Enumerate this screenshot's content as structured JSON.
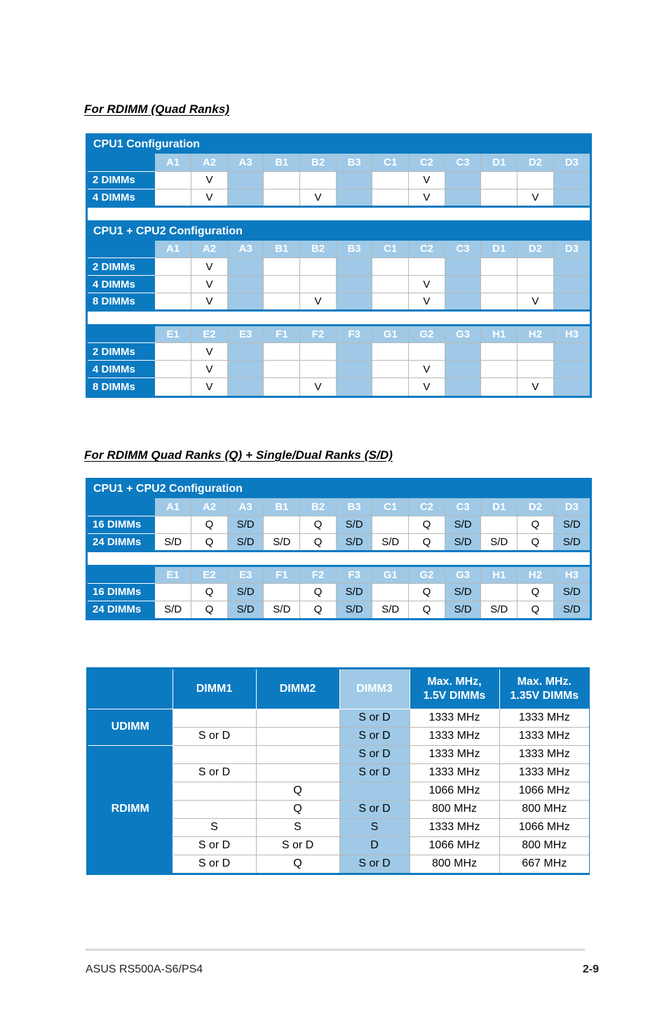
{
  "document": {
    "footer_left": "ASUS RS500A-S6/PS4",
    "page_number": "2-9"
  },
  "colors": {
    "brand_blue": "#0c7ac1",
    "light_blue": "#9fc9e6",
    "grid_gray": "#b8b8b8",
    "footer_rule": "#d9d9d9"
  },
  "section1": {
    "heading": "For RDIMM (Quad Ranks)",
    "block1": {
      "title": "CPU1 Configuration",
      "columns": [
        "A1",
        "A2",
        "A3",
        "B1",
        "B2",
        "B3",
        "C1",
        "C2",
        "C3",
        "D1",
        "D2",
        "D3"
      ],
      "shaded_columns": [
        2,
        5,
        8,
        11
      ],
      "rows": [
        {
          "label": "2 DIMMs",
          "values": [
            "",
            "V",
            "",
            "",
            "",
            "",
            "",
            "V",
            "",
            "",
            "",
            ""
          ]
        },
        {
          "label": "4 DIMMs",
          "values": [
            "",
            "V",
            "",
            "",
            "V",
            "",
            "",
            "V",
            "",
            "",
            "V",
            ""
          ]
        }
      ]
    },
    "block2": {
      "title": "CPU1 + CPU2 Configuration",
      "columns": [
        "A1",
        "A2",
        "A3",
        "B1",
        "B2",
        "B3",
        "C1",
        "C2",
        "C3",
        "D1",
        "D2",
        "D3"
      ],
      "shaded_columns": [
        2,
        5,
        8,
        11
      ],
      "rows": [
        {
          "label": "2 DIMMs",
          "values": [
            "",
            "V",
            "",
            "",
            "",
            "",
            "",
            "",
            "",
            "",
            "",
            ""
          ]
        },
        {
          "label": "4 DIMMs",
          "values": [
            "",
            "V",
            "",
            "",
            "",
            "",
            "",
            "V",
            "",
            "",
            "",
            ""
          ]
        },
        {
          "label": "8 DIMMs",
          "values": [
            "",
            "V",
            "",
            "",
            "V",
            "",
            "",
            "V",
            "",
            "",
            "V",
            ""
          ]
        }
      ]
    },
    "block3": {
      "title": "",
      "columns": [
        "E1",
        "E2",
        "E3",
        "F1",
        "F2",
        "F3",
        "G1",
        "G2",
        "G3",
        "H1",
        "H2",
        "H3"
      ],
      "shaded_columns": [
        2,
        5,
        8,
        11
      ],
      "rows": [
        {
          "label": "2 DIMMs",
          "values": [
            "",
            "V",
            "",
            "",
            "",
            "",
            "",
            "",
            "",
            "",
            "",
            ""
          ]
        },
        {
          "label": "4 DIMMs",
          "values": [
            "",
            "V",
            "",
            "",
            "",
            "",
            "",
            "V",
            "",
            "",
            "",
            ""
          ]
        },
        {
          "label": "8 DIMMs",
          "values": [
            "",
            "V",
            "",
            "",
            "V",
            "",
            "",
            "V",
            "",
            "",
            "V",
            ""
          ]
        }
      ]
    }
  },
  "section2": {
    "heading": "For RDIMM Quad Ranks (Q) + Single/Dual Ranks (S/D)",
    "block1": {
      "title": "CPU1 + CPU2 Configuration",
      "columns": [
        "A1",
        "A2",
        "A3",
        "B1",
        "B2",
        "B3",
        "C1",
        "C2",
        "C3",
        "D1",
        "D2",
        "D3"
      ],
      "shaded_columns": [
        2,
        5,
        8,
        11
      ],
      "rows": [
        {
          "label": "16 DIMMs",
          "values": [
            "",
            "Q",
            "S/D",
            "",
            "Q",
            "S/D",
            "",
            "Q",
            "S/D",
            "",
            "Q",
            "S/D"
          ]
        },
        {
          "label": "24 DIMMs",
          "values": [
            "S/D",
            "Q",
            "S/D",
            "S/D",
            "Q",
            "S/D",
            "S/D",
            "Q",
            "S/D",
            "S/D",
            "Q",
            "S/D"
          ]
        }
      ]
    },
    "block2": {
      "title": "",
      "columns": [
        "E1",
        "E2",
        "E3",
        "F1",
        "F2",
        "F3",
        "G1",
        "G2",
        "G3",
        "H1",
        "H2",
        "H3"
      ],
      "shaded_columns": [
        2,
        5,
        8,
        11
      ],
      "rows": [
        {
          "label": "16 DIMMs",
          "values": [
            "",
            "Q",
            "S/D",
            "",
            "Q",
            "S/D",
            "",
            "Q",
            "S/D",
            "",
            "Q",
            "S/D"
          ]
        },
        {
          "label": "24 DIMMs",
          "values": [
            "S/D",
            "Q",
            "S/D",
            "S/D",
            "Q",
            "S/D",
            "S/D",
            "Q",
            "S/D",
            "S/D",
            "Q",
            "S/D"
          ]
        }
      ]
    }
  },
  "speed_table": {
    "headers": [
      "",
      "DIMM1",
      "DIMM2",
      "DIMM3",
      "Max. MHz,\n1.5V DIMMs",
      "Max. MHz.\n1.35V DIMMs"
    ],
    "header_dimm1": "DIMM1",
    "header_dimm2": "DIMM2",
    "header_dimm3": "DIMM3",
    "header_max_15v_line1": "Max. MHz,",
    "header_max_15v_line2": "1.5V DIMMs",
    "header_max_135v_line1": "Max. MHz.",
    "header_max_135v_line2": "1.35V DIMMs",
    "groups": [
      {
        "name": "UDIMM",
        "rowspan": 2
      },
      {
        "name": "RDIMM",
        "rowspan": 7
      }
    ],
    "rows": [
      {
        "group": "UDIMM",
        "dimm1": "",
        "dimm2": "",
        "dimm3": "S or D",
        "max_15v": "1333 MHz",
        "max_135v": "1333 MHz"
      },
      {
        "group": "UDIMM",
        "dimm1": "S or D",
        "dimm2": "",
        "dimm3": "S or D",
        "max_15v": "1333 MHz",
        "max_135v": "1333 MHz"
      },
      {
        "group": "RDIMM",
        "dimm1": "",
        "dimm2": "",
        "dimm3": "S or D",
        "max_15v": "1333 MHz",
        "max_135v": "1333 MHz"
      },
      {
        "group": "RDIMM",
        "dimm1": "S or D",
        "dimm2": "",
        "dimm3": "S or D",
        "max_15v": "1333 MHz",
        "max_135v": "1333 MHz"
      },
      {
        "group": "RDIMM",
        "dimm1": "",
        "dimm2": "Q",
        "dimm3": "",
        "max_15v": "1066 MHz",
        "max_135v": "1066 MHz"
      },
      {
        "group": "RDIMM",
        "dimm1": "",
        "dimm2": "Q",
        "dimm3": "S or D",
        "max_15v": "800 MHz",
        "max_135v": "800 MHz"
      },
      {
        "group": "RDIMM",
        "dimm1": "S",
        "dimm2": "S",
        "dimm3": "S",
        "max_15v": "1333 MHz",
        "max_135v": "1066 MHz"
      },
      {
        "group": "RDIMM",
        "dimm1": "S or D",
        "dimm2": "S or D",
        "dimm3": "D",
        "max_15v": "1066 MHz",
        "max_135v": "800 MHz"
      },
      {
        "group": "RDIMM",
        "dimm1": "S or D",
        "dimm2": "Q",
        "dimm3": "S or D",
        "max_15v": "800 MHz",
        "max_135v": "667 MHz"
      }
    ]
  }
}
